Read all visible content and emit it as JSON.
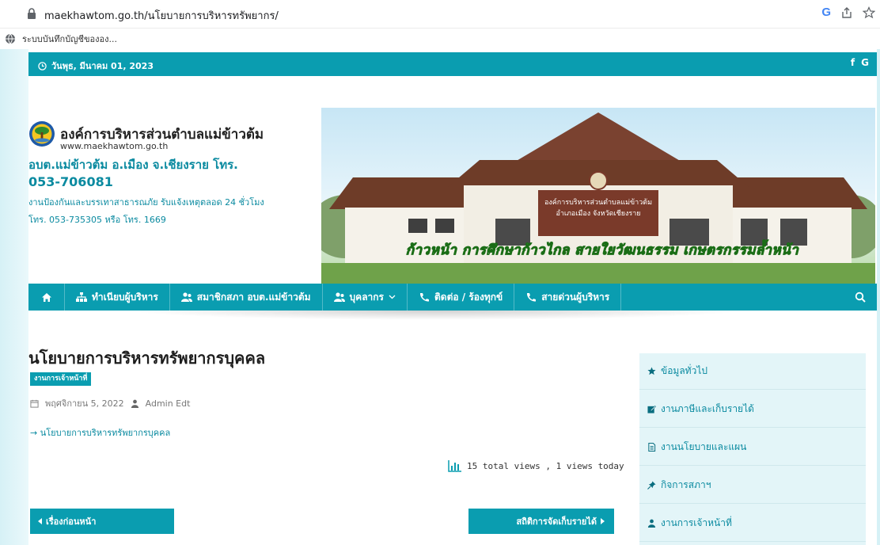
{
  "browser": {
    "url": "maekhawtom.go.th/นโยบายการบริหารทรัพยากร/",
    "bookmark_label": "ระบบบันทึกบัญชีขององ..."
  },
  "topbar": {
    "date": "วันพุธ, มีนาคม 01, 2023",
    "social_f": "f",
    "social_g": "G"
  },
  "header": {
    "org_name": "องค์การบริหารส่วนตำบลแม่ข้าวต้ม",
    "org_site": "www.maekhawtom.go.th",
    "org_short": "อบต.แม่ข้าวต้ม อ.เมือง จ.เชียงราย โทร.",
    "org_phone": "053-706081",
    "emergency": "งานป้องกันและบรรเทาสาธารณภัย รับแจ้งเหตุตลอด 24 ชั่วโมง",
    "hotline": "โทร. 053-735305 หรือ โทร. 1669",
    "building_sign_1": "องค์การบริหารส่วนตำบลแม่ข้าวต้ม",
    "building_sign_2": "อำเภอเมือง จังหวัดเชียงราย",
    "motto": "ก้าวหน้า การศึกษาก้าวไกล สายใยวัฒนธรรม เกษตรกรรมล้ำหน้า"
  },
  "nav": {
    "items": [
      {
        "label": "ทำเนียบผู้บริหาร"
      },
      {
        "label": "สมาชิกสภา อบต.แม่ข้าวต้ม"
      },
      {
        "label": "บุคลากร"
      },
      {
        "label": "ติดต่อ / ร้องทุกข์"
      },
      {
        "label": "สายด่วนผู้บริหาร"
      }
    ]
  },
  "post": {
    "title": "นโยบายการบริหารทรัพยากรบุคคล",
    "category": "งานการเจ้าหน้าที่",
    "date": "พฤศจิกายน 5, 2022",
    "author": "Admin Edt",
    "link_text": "→ นโยบายการบริหารทรัพยากรบุคคล",
    "views": "15 total views , 1 views today",
    "prev_label": "เรื่องก่อนหน้า",
    "next_label": "สถิติการจัดเก็บรายได้"
  },
  "sidebar": {
    "items": [
      {
        "label": "ข้อมูลทั่วไป",
        "icon": "star-icon"
      },
      {
        "label": "งานภาษีและเก็บรายได้",
        "icon": "edit-icon"
      },
      {
        "label": "งานนโยบายและแผน",
        "icon": "document-icon"
      },
      {
        "label": "กิจการสภาฯ",
        "icon": "pin-icon"
      },
      {
        "label": "งานการเจ้าหน้าที่",
        "icon": "user-icon"
      }
    ]
  },
  "colors": {
    "primary": "#0a9db0",
    "link": "#0a8aa0",
    "sidebar_bg": "#e3f5f8"
  }
}
